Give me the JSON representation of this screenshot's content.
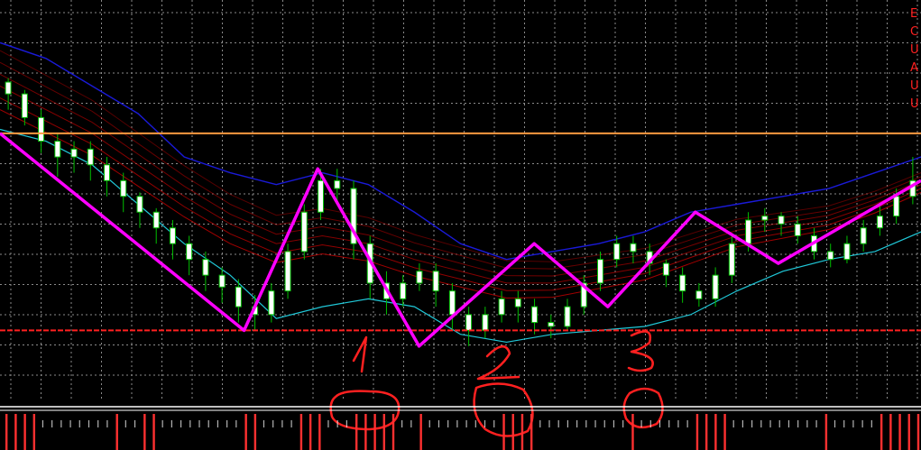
{
  "chart_data": {
    "type": "line",
    "title": "",
    "xlabel": "",
    "ylabel": "",
    "xlim": [
      0,
      100
    ],
    "ylim": [
      0,
      100
    ],
    "grid": true,
    "colors": {
      "background": "#000000",
      "grid": "#8a8a8a",
      "candle_bull": "#ffffff",
      "candle_bear": "#ffffff",
      "candle_outline": "#00c000",
      "zigzag": "#ff00ff",
      "upper_band": "#1a1ad8",
      "lower_band": "#20c8d8",
      "ma_ribbon": "#c00000",
      "resistance": "#ff9a40",
      "support": "#ff2020",
      "annotation": "#ff2020",
      "histogram": "#ff3030",
      "histogram_minor": "#ffffff"
    },
    "side_labels": [
      "E",
      "C",
      "U",
      "A",
      "U",
      "U"
    ],
    "levels": {
      "resistance": 68,
      "support": 18
    },
    "zigzag": {
      "x": [
        0,
        26.5,
        34.5,
        45.5,
        58,
        66,
        75.5,
        84.5,
        100
      ],
      "y": [
        68,
        18,
        59,
        14,
        40,
        24,
        48,
        35,
        56
      ]
    },
    "series": [
      {
        "x": [
          0,
          5,
          10,
          15,
          20,
          25,
          30,
          35,
          40,
          45,
          50,
          55,
          60,
          65,
          70,
          75,
          80,
          85,
          90,
          95,
          100
        ],
        "values": [
          91,
          87,
          80,
          73,
          62,
          58,
          55,
          58,
          55,
          48,
          40,
          36,
          38,
          40,
          43,
          48,
          50,
          52,
          54,
          58,
          62
        ]
      },
      {
        "x": [
          0,
          5,
          10,
          15,
          20,
          25,
          30,
          35,
          40,
          45,
          50,
          55,
          60,
          65,
          70,
          75,
          80,
          85,
          90,
          95,
          100
        ],
        "values": [
          69,
          66,
          60,
          50,
          40,
          32,
          21,
          24,
          26,
          24,
          17,
          15,
          17,
          18,
          19,
          22,
          28,
          33,
          36,
          38,
          43
        ]
      },
      {
        "x": [
          0,
          5,
          10,
          15,
          20,
          25,
          30,
          35,
          40,
          45,
          50,
          55,
          60,
          65,
          70,
          75,
          80,
          85,
          90,
          95,
          100
        ],
        "values": [
          80,
          74,
          68,
          60,
          52,
          45,
          40,
          42,
          40,
          36,
          33,
          30,
          30,
          32,
          34,
          38,
          42,
          44,
          46,
          50,
          55
        ]
      }
    ],
    "candles": [
      [
        81,
        78,
        82,
        74
      ],
      [
        78,
        72,
        79,
        70
      ],
      [
        72,
        66,
        74,
        63
      ],
      [
        66,
        62,
        68,
        57
      ],
      [
        62,
        64,
        66,
        58
      ],
      [
        64,
        60,
        66,
        56
      ],
      [
        60,
        56,
        62,
        52
      ],
      [
        56,
        52,
        58,
        48
      ],
      [
        52,
        48,
        53,
        44
      ],
      [
        48,
        44,
        49,
        40
      ],
      [
        44,
        40,
        46,
        36
      ],
      [
        40,
        36,
        42,
        32
      ],
      [
        36,
        32,
        38,
        28
      ],
      [
        32,
        29,
        34,
        25
      ],
      [
        29,
        24,
        31,
        20
      ],
      [
        24,
        22,
        27,
        18
      ],
      [
        22,
        28,
        30,
        20
      ],
      [
        28,
        38,
        40,
        26
      ],
      [
        38,
        48,
        50,
        36
      ],
      [
        48,
        56,
        59,
        46
      ],
      [
        56,
        54,
        59,
        50
      ],
      [
        54,
        40,
        56,
        36
      ],
      [
        40,
        30,
        42,
        26
      ],
      [
        30,
        26,
        33,
        22
      ],
      [
        26,
        30,
        32,
        24
      ],
      [
        30,
        33,
        35,
        28
      ],
      [
        33,
        28,
        35,
        24
      ],
      [
        28,
        22,
        30,
        18
      ],
      [
        22,
        18,
        24,
        14
      ],
      [
        18,
        22,
        24,
        16
      ],
      [
        22,
        26,
        28,
        20
      ],
      [
        26,
        24,
        28,
        20
      ],
      [
        24,
        20,
        26,
        17
      ],
      [
        20,
        19,
        22,
        16
      ],
      [
        19,
        24,
        26,
        18
      ],
      [
        24,
        30,
        32,
        22
      ],
      [
        30,
        36,
        38,
        28
      ],
      [
        36,
        40,
        42,
        34
      ],
      [
        40,
        38,
        42,
        35
      ],
      [
        38,
        35,
        40,
        32
      ],
      [
        35,
        32,
        36,
        29
      ],
      [
        32,
        28,
        34,
        25
      ],
      [
        28,
        26,
        30,
        24
      ],
      [
        26,
        32,
        34,
        24
      ],
      [
        32,
        40,
        42,
        30
      ],
      [
        40,
        46,
        48,
        38
      ],
      [
        46,
        47,
        49,
        43
      ],
      [
        47,
        45,
        48,
        42
      ],
      [
        45,
        42,
        47,
        40
      ],
      [
        42,
        38,
        44,
        36
      ],
      [
        38,
        36,
        40,
        34
      ],
      [
        36,
        40,
        42,
        35
      ],
      [
        40,
        44,
        46,
        38
      ],
      [
        44,
        47,
        50,
        42
      ],
      [
        47,
        52,
        54,
        45
      ],
      [
        52,
        56,
        62,
        50
      ]
    ],
    "histogram": [
      1,
      1,
      1,
      1,
      0,
      0,
      0,
      0,
      0,
      0,
      0,
      0,
      1,
      0,
      0,
      1,
      1,
      0,
      0,
      0,
      0,
      0,
      0,
      0,
      0,
      0,
      1,
      1,
      0,
      0,
      0,
      0,
      1,
      1,
      1,
      0,
      0,
      0,
      1,
      1,
      1,
      1,
      1,
      0,
      0,
      1,
      0,
      0,
      0,
      0,
      0,
      0,
      0,
      0,
      1,
      1,
      1,
      1,
      0,
      0,
      0,
      0,
      0,
      0,
      0,
      0,
      0,
      0,
      1,
      0,
      0,
      0,
      0,
      0,
      0,
      1,
      1,
      1,
      1,
      0,
      0,
      0,
      0,
      0,
      0,
      0,
      0,
      0,
      0,
      1,
      0,
      0,
      0,
      0,
      0,
      1,
      1,
      1,
      1,
      1
    ]
  }
}
